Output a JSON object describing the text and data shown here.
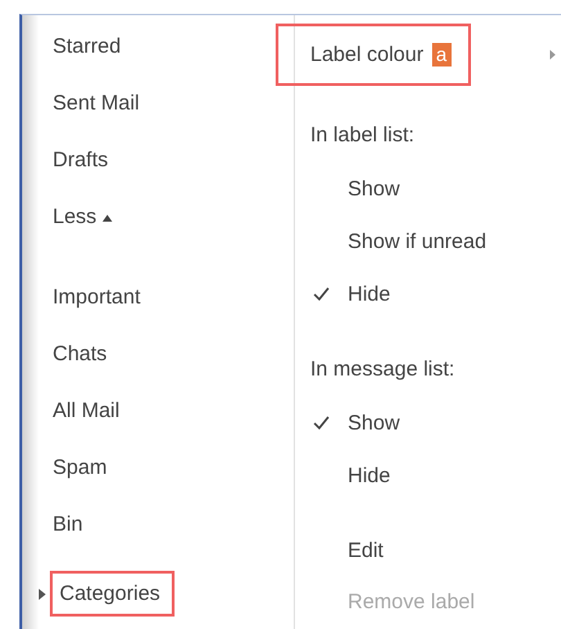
{
  "sidebar": {
    "items": [
      {
        "label": "Starred",
        "kind": "link",
        "highlighted": false
      },
      {
        "label": "Sent Mail",
        "kind": "link",
        "highlighted": false
      },
      {
        "label": "Drafts",
        "kind": "link",
        "highlighted": false
      },
      {
        "label": "Less",
        "kind": "toggle",
        "highlighted": false
      },
      {
        "label": "Important",
        "kind": "link",
        "highlighted": false
      },
      {
        "label": "Chats",
        "kind": "link",
        "highlighted": false
      },
      {
        "label": "All Mail",
        "kind": "link",
        "highlighted": false
      },
      {
        "label": "Spam",
        "kind": "link",
        "highlighted": false
      },
      {
        "label": "Bin",
        "kind": "link",
        "highlighted": false
      },
      {
        "label": "Categories",
        "kind": "expander",
        "highlighted": true
      }
    ]
  },
  "menu": {
    "sections": [
      {
        "items": [
          {
            "kind": "submenu",
            "label": "Label colour",
            "highlighted": true,
            "swatch": {
              "text": "a",
              "color": "#e8743b"
            }
          }
        ]
      },
      {
        "header": "In label list:",
        "items": [
          {
            "kind": "option",
            "label": "Show",
            "checked": false
          },
          {
            "kind": "option",
            "label": "Show if unread",
            "checked": false
          },
          {
            "kind": "option",
            "label": "Hide",
            "checked": true
          }
        ]
      },
      {
        "header": "In message list:",
        "items": [
          {
            "kind": "option",
            "label": "Show",
            "checked": true
          },
          {
            "kind": "option",
            "label": "Hide",
            "checked": false
          }
        ]
      },
      {
        "items": [
          {
            "kind": "action",
            "label": "Edit",
            "disabled": false
          },
          {
            "kind": "action",
            "label": "Remove label",
            "disabled": true
          }
        ]
      }
    ]
  }
}
